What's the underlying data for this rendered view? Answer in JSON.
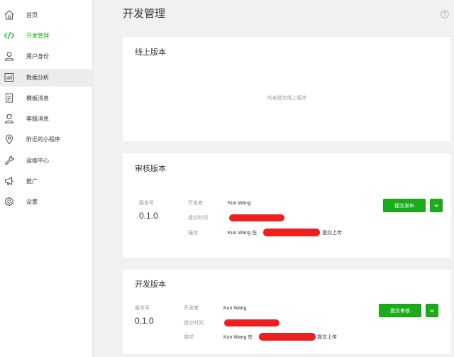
{
  "sidebar": {
    "items": [
      {
        "label": "首页",
        "icon": "home-icon"
      },
      {
        "label": "开发管理",
        "icon": "code-icon",
        "active": true
      },
      {
        "label": "用户身份",
        "icon": "user-icon"
      },
      {
        "label": "数据分析",
        "icon": "bar-chart-icon"
      },
      {
        "label": "模板消息",
        "icon": "document-icon"
      },
      {
        "label": "客服消息",
        "icon": "support-agent-icon"
      },
      {
        "label": "附近的小程序",
        "icon": "location-pin-icon"
      },
      {
        "label": "运维中心",
        "icon": "wrench-icon"
      },
      {
        "label": "推广",
        "icon": "megaphone-icon"
      },
      {
        "label": "设置",
        "icon": "gear-icon"
      }
    ]
  },
  "header": {
    "title": "开发管理",
    "help_icon": "question-circle-icon"
  },
  "online": {
    "title": "线上版本",
    "empty_text": "尚未提交线上版本"
  },
  "review": {
    "title": "审核版本",
    "version_label": "版本号",
    "version": "0.1.0",
    "developer_label": "开发者",
    "developer": "Kun Wang",
    "time_label": "提交时间",
    "desc_label": "描述",
    "desc_prefix": "Kun Wang 在",
    "desc_suffix": "提交上传",
    "submit_label": "提交发布"
  },
  "dev": {
    "title": "开发版本",
    "version_label": "版本号",
    "version": "0.1.0",
    "developer_label": "开发者",
    "developer": "Kun Wang",
    "time_label": "提交时间",
    "desc_label": "描述",
    "desc_prefix": "Kun Wang 在",
    "desc_suffix": "提交上传",
    "submit_label": "提交审核"
  },
  "colors": {
    "accent": "#1aad19",
    "redaction": "#ee1f1f"
  }
}
